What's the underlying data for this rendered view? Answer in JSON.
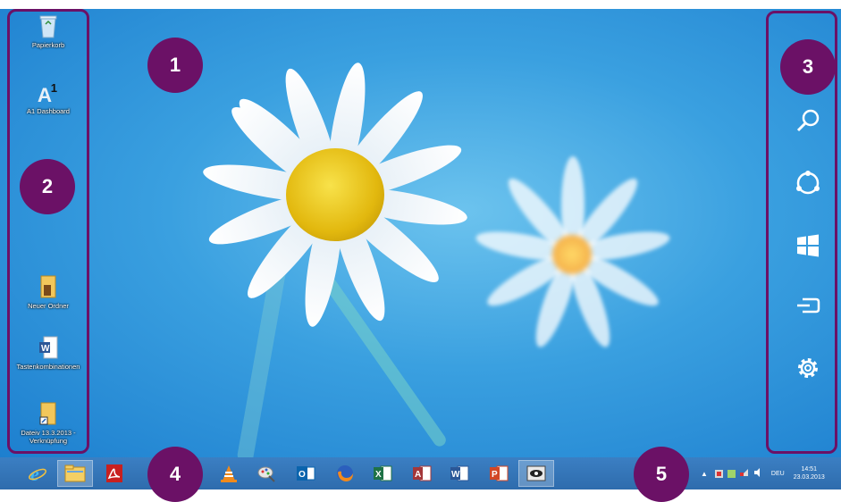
{
  "desktop_icons": [
    {
      "label": "Papierkorb",
      "icon": "recycle-bin-icon"
    },
    {
      "label": "A1 Dashboard",
      "icon": "a1-dashboard-icon"
    },
    {
      "label": "Neuer Ordner",
      "icon": "folder-icon"
    },
    {
      "label": "Tastenkombinationen",
      "icon": "word-document-icon"
    },
    {
      "label": "Dateiv 13.3.2013 - Verknüpfung",
      "icon": "folder-shortcut-icon"
    }
  ],
  "annotations": [
    "1",
    "2",
    "3",
    "4",
    "5"
  ],
  "charms": [
    "search-icon",
    "share-icon",
    "start-icon",
    "devices-icon",
    "settings-icon"
  ],
  "taskbar_apps": [
    "internet-explorer-icon",
    "file-explorer-icon",
    "adobe-reader-icon",
    "vlc-icon",
    "paint-icon",
    "outlook-icon",
    "firefox-icon",
    "excel-icon",
    "access-icon",
    "word-icon",
    "powerpoint-icon",
    "viewer-icon"
  ],
  "tray": {
    "language": "DEU",
    "time": "14:51",
    "date": "23.03.2013"
  },
  "colors": {
    "annotation": "#6b1166",
    "taskbar": "#3274b8"
  }
}
